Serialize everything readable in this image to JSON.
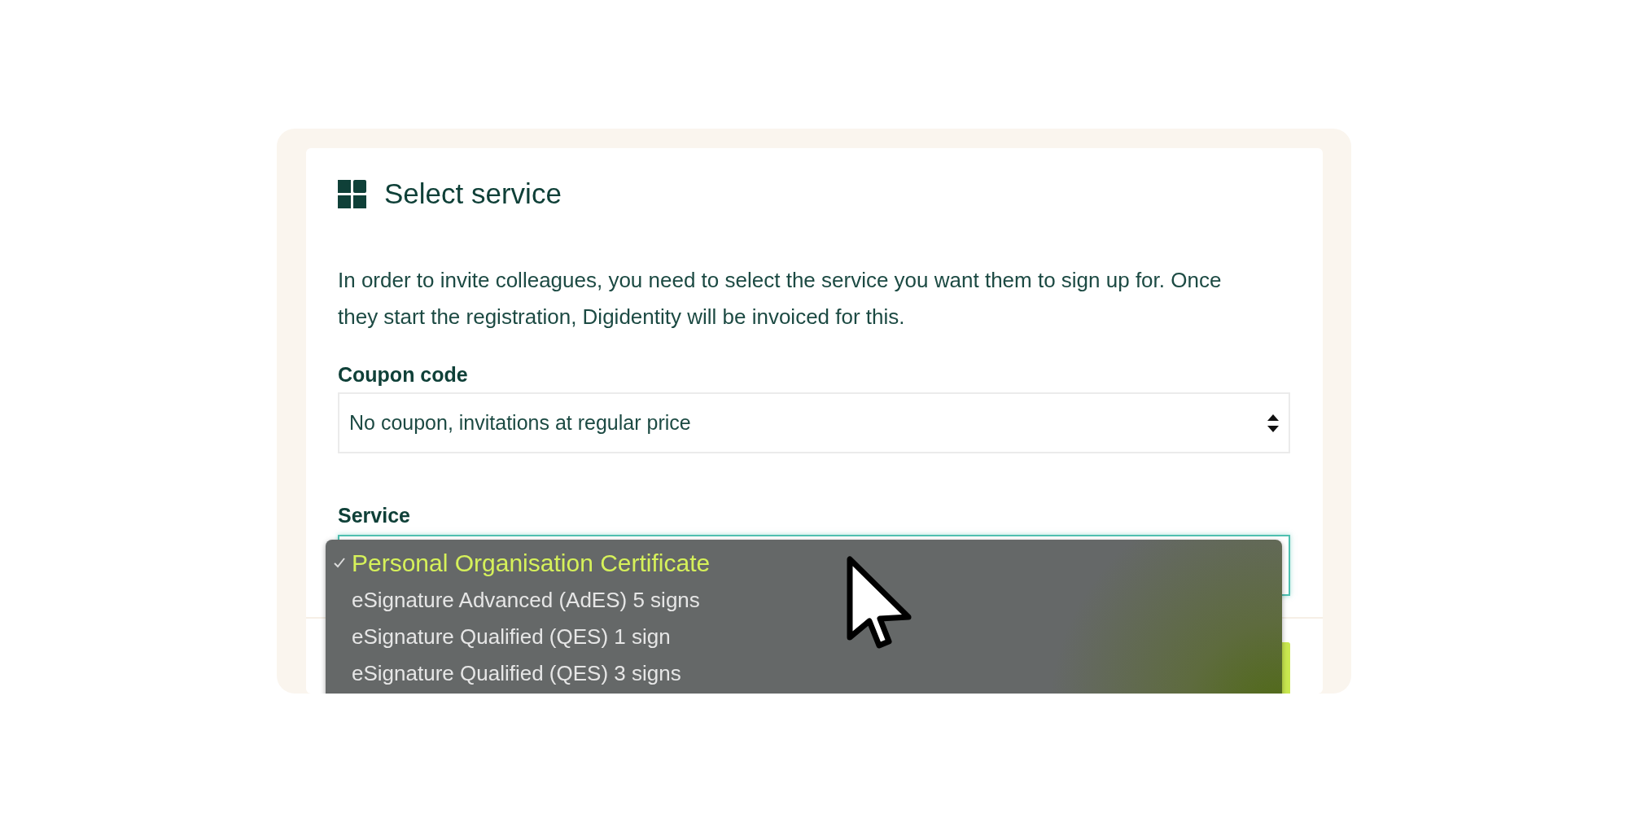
{
  "card": {
    "title": "Select service",
    "description": "In order to invite colleagues, you need to select the service you want them to sign up for. Once they start the registration, Digidentity will be invoiced for this.",
    "fields": [
      {
        "label": "Coupon code",
        "kind": "select",
        "value": "No coupon, invitations at regular price",
        "focused": false
      },
      {
        "label": "Service",
        "kind": "select",
        "focused": true
      }
    ]
  },
  "dropdown": {
    "options": [
      {
        "label": "Personal Organisation Certificate",
        "selected": true
      },
      {
        "label": "eSignature Advanced (AdES) 5 signs",
        "selected": false
      },
      {
        "label": "eSignature Qualified (QES) 1 sign",
        "selected": false
      },
      {
        "label": "eSignature Qualified (QES) 3 signs",
        "selected": false
      }
    ]
  }
}
